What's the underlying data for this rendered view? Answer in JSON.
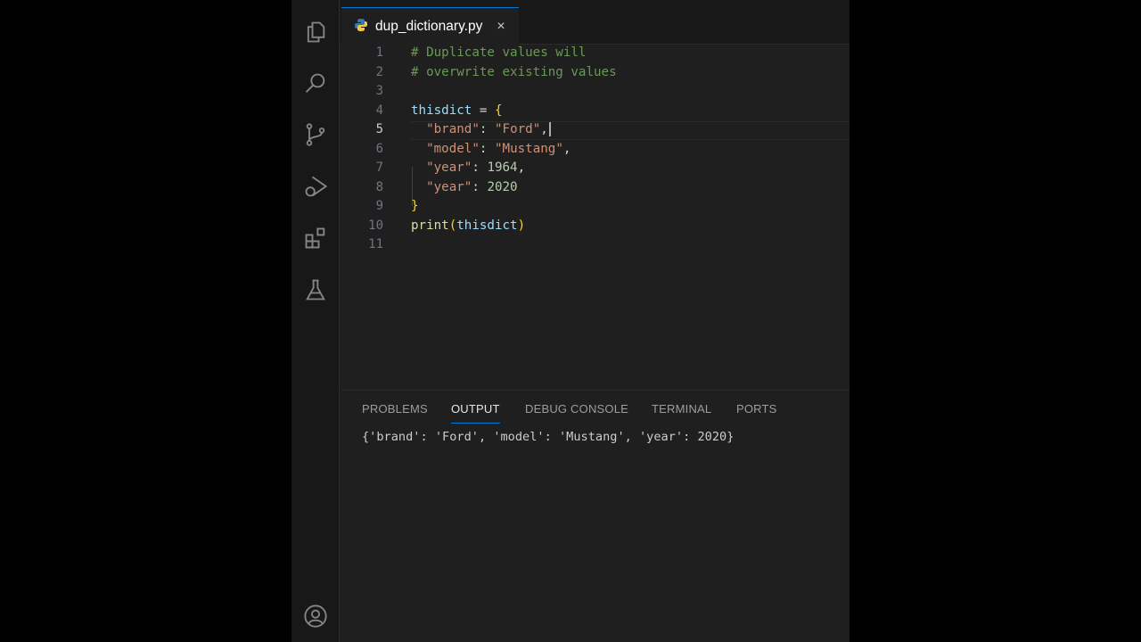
{
  "tab": {
    "filename": "dup_dictionary.py",
    "close": "×"
  },
  "editor": {
    "current_line": 5,
    "lines": [
      [
        [
          "# Duplicate values will",
          "c"
        ]
      ],
      [
        [
          "# overwrite existing values",
          "c"
        ]
      ],
      [],
      [
        [
          "thisdict",
          "v"
        ],
        [
          " = ",
          "p"
        ],
        [
          "{",
          "b"
        ]
      ],
      [
        [
          "  ",
          "p"
        ],
        [
          "\"brand\"",
          "s"
        ],
        [
          ": ",
          "p"
        ],
        [
          "\"Ford\"",
          "s"
        ],
        [
          ",",
          "p"
        ]
      ],
      [
        [
          "  ",
          "p"
        ],
        [
          "\"model\"",
          "s"
        ],
        [
          ": ",
          "p"
        ],
        [
          "\"Mustang\"",
          "s"
        ],
        [
          ",",
          "p"
        ]
      ],
      [
        [
          "  ",
          "p"
        ],
        [
          "\"year\"",
          "s"
        ],
        [
          ": ",
          "p"
        ],
        [
          "1964",
          "n"
        ],
        [
          ",",
          "p"
        ]
      ],
      [
        [
          "  ",
          "p"
        ],
        [
          "\"year\"",
          "s"
        ],
        [
          ": ",
          "p"
        ],
        [
          "2020",
          "n"
        ]
      ],
      [
        [
          "}",
          "b"
        ]
      ],
      [
        [
          "print",
          "f"
        ],
        [
          "(",
          "b"
        ],
        [
          "thisdict",
          "v"
        ],
        [
          ")",
          "b"
        ]
      ],
      []
    ]
  },
  "panel": {
    "tabs": [
      "PROBLEMS",
      "OUTPUT",
      "DEBUG CONSOLE",
      "TERMINAL",
      "PORTS"
    ],
    "active_tab": "OUTPUT",
    "output": "{'brand': 'Ford', 'model': 'Mustang', 'year': 2020}"
  }
}
